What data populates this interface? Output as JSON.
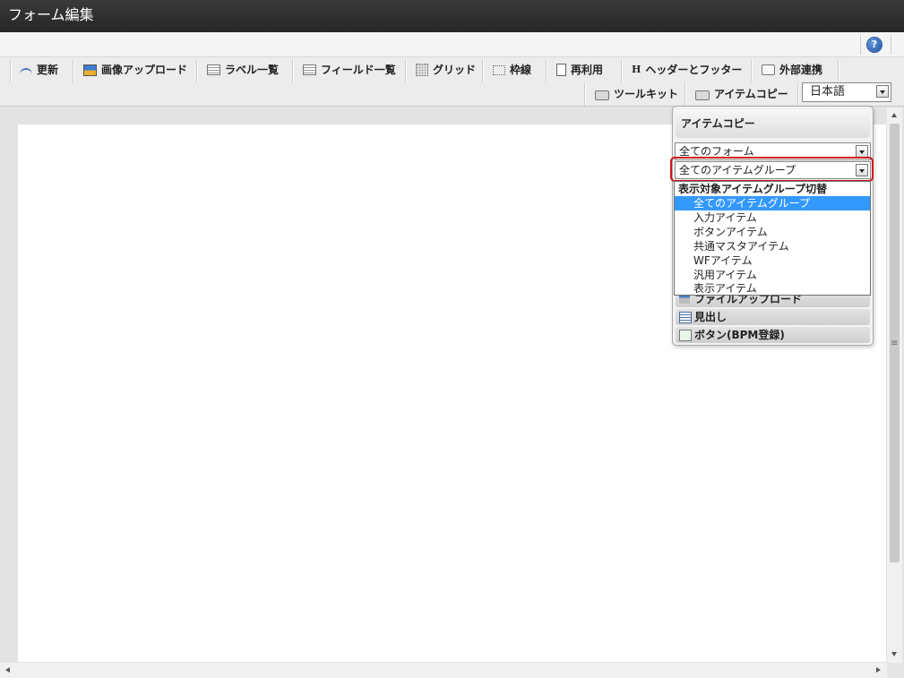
{
  "window": {
    "title": "フォーム編集"
  },
  "help": {
    "label": "?"
  },
  "toolbar": {
    "row1": [
      {
        "label": "更新",
        "icon": "refresh-icon"
      },
      {
        "label": "画像アップロード",
        "icon": "image-upload-icon"
      },
      {
        "label": "ラベル一覧",
        "icon": "label-list-icon"
      },
      {
        "label": "フィールド一覧",
        "icon": "field-list-icon"
      },
      {
        "label": "グリッド",
        "icon": "grid-icon"
      },
      {
        "label": "枠線",
        "icon": "border-icon"
      },
      {
        "label": "再利用",
        "icon": "reuse-icon"
      },
      {
        "label": "ヘッダーとフッター",
        "icon": "header-footer-icon"
      },
      {
        "label": "外部連携",
        "icon": "external-link-icon"
      }
    ],
    "row2": [
      {
        "label": "ツールキット",
        "icon": "toolkit-icon"
      },
      {
        "label": "アイテムコピー",
        "icon": "item-copy-icon"
      }
    ],
    "language": {
      "selected": "日本語"
    }
  },
  "panel": {
    "title": "アイテムコピー",
    "form_select": "全てのフォーム",
    "group_select": "全てのアイテムグループ",
    "groups_behind": [
      {
        "label": "ファイルアップロード",
        "icon": "file-upload-icon"
      },
      {
        "label": "見出し",
        "icon": "heading-icon"
      },
      {
        "label": "ボタン(BPM登録)",
        "icon": "bpm-button-icon"
      }
    ],
    "dropdown": {
      "group_label": "表示対象アイテムグループ切替",
      "options": [
        "全てのアイテムグループ",
        "入力アイテム",
        "ボタンアイテム",
        "共通マスタアイテム",
        "WFアイテム",
        "汎用アイテム",
        "表示アイテム"
      ],
      "selected_index": 0
    }
  }
}
